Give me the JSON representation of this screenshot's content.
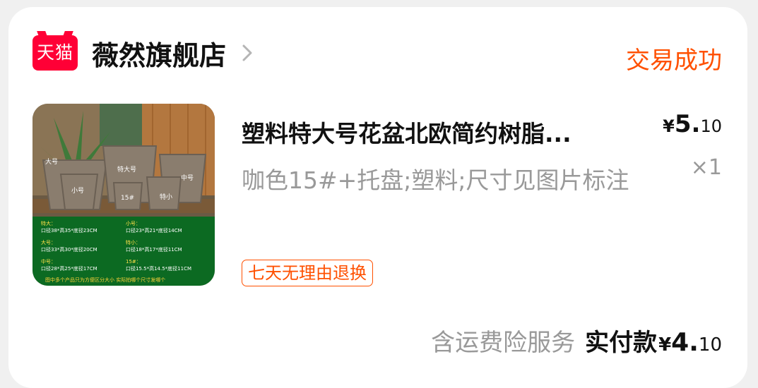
{
  "shop": {
    "logo_text": "天猫",
    "name": "薇然旗舰店",
    "status": "交易成功"
  },
  "product": {
    "title": "塑料特大号花盆北欧简约树脂...",
    "spec": "咖色15#+托盘;塑料;尺寸见图片标注",
    "price_currency": "¥",
    "price_int": "5.",
    "price_dec": "10",
    "quantity": "×1",
    "tag": "七天无理由退换",
    "image": {
      "labels": {
        "big": "大号",
        "xl": "特大号",
        "medium": "中号",
        "small": "小号",
        "num15": "15#",
        "xs": "特小"
      },
      "size_table": [
        {
          "name": "特大：",
          "dims": "口径38*高35*底径23CM"
        },
        {
          "name": "大号：",
          "dims": "口径33*高30*底径20CM"
        },
        {
          "name": "中号：",
          "dims": "口径28*高25*底径17CM"
        },
        {
          "name": "小号：",
          "dims": "口径23*高21*底径14CM"
        },
        {
          "name": "特小：",
          "dims": "口径18*高17*底径11CM"
        },
        {
          "name": "15#：",
          "dims": "口径15.5*高14.5*底径11CM"
        }
      ],
      "footnote": "图中多个产品只为方便区分大小 实际拍哪个尺寸发哪个"
    }
  },
  "footer": {
    "insurance_text": "含运费险服务",
    "paid_label": "实付款",
    "paid_currency": "¥",
    "paid_int": "4.",
    "paid_dec": "10"
  },
  "colors": {
    "accent": "#ff5000",
    "tmall_red": "#ff0036",
    "muted": "#999999"
  }
}
